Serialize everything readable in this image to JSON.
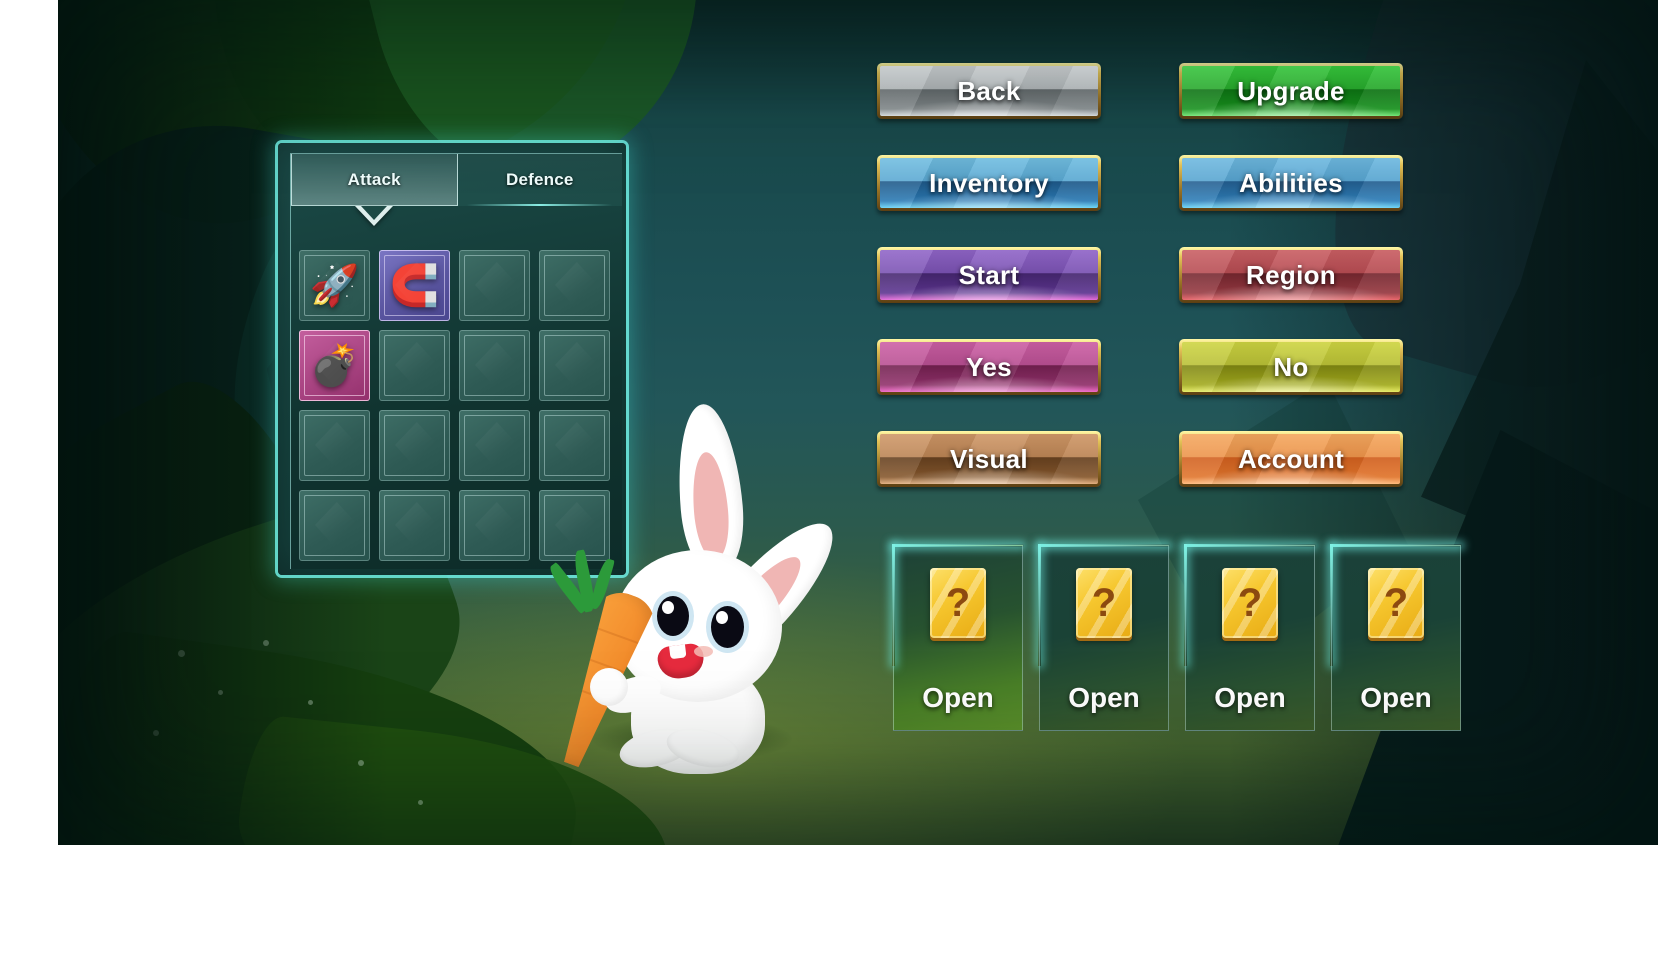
{
  "scene": {
    "theme": "jungle-night",
    "colors": {
      "background_top": "#18484a",
      "background_mid": "#225659",
      "background_ground": "#44632f",
      "panel_glow": "#6eebe1",
      "gold_border": "#e3c258"
    }
  },
  "inventory_panel": {
    "tabs": [
      {
        "label": "Attack",
        "active": true
      },
      {
        "label": "Defence",
        "active": false
      }
    ],
    "slots": [
      {
        "index": 1,
        "icon": "rocket-icon",
        "glyph": "🚀",
        "rarity": "common",
        "filled": true
      },
      {
        "index": 2,
        "icon": "magnet-icon",
        "glyph": "🧲",
        "rarity": "rare",
        "filled": true
      },
      {
        "index": 3,
        "icon": "empty-slot",
        "glyph": "",
        "rarity": "common",
        "filled": false
      },
      {
        "index": 4,
        "icon": "empty-slot",
        "glyph": "",
        "rarity": "common",
        "filled": false
      },
      {
        "index": 5,
        "icon": "bomb-icon",
        "glyph": "💣",
        "rarity": "epic",
        "filled": true
      },
      {
        "index": 6,
        "icon": "empty-slot",
        "glyph": "",
        "rarity": "common",
        "filled": false
      },
      {
        "index": 7,
        "icon": "empty-slot",
        "glyph": "",
        "rarity": "common",
        "filled": false
      },
      {
        "index": 8,
        "icon": "empty-slot",
        "glyph": "",
        "rarity": "common",
        "filled": false
      },
      {
        "index": 9,
        "icon": "empty-slot",
        "glyph": "",
        "rarity": "common",
        "filled": false
      },
      {
        "index": 10,
        "icon": "empty-slot",
        "glyph": "",
        "rarity": "common",
        "filled": false
      },
      {
        "index": 11,
        "icon": "empty-slot",
        "glyph": "",
        "rarity": "common",
        "filled": false
      },
      {
        "index": 12,
        "icon": "empty-slot",
        "glyph": "",
        "rarity": "common",
        "filled": false
      },
      {
        "index": 13,
        "icon": "empty-slot",
        "glyph": "",
        "rarity": "common",
        "filled": false
      },
      {
        "index": 14,
        "icon": "empty-slot",
        "glyph": "",
        "rarity": "common",
        "filled": false
      },
      {
        "index": 15,
        "icon": "empty-slot",
        "glyph": "",
        "rarity": "common",
        "filled": false
      },
      {
        "index": 16,
        "icon": "empty-slot",
        "glyph": "",
        "rarity": "common",
        "filled": false
      }
    ]
  },
  "menu": {
    "rows": [
      {
        "left": {
          "label": "Back",
          "color_top": "#b9bec0",
          "color_bottom": "#6a7173",
          "glow": "#e8edef"
        },
        "right": {
          "label": "Upgrade",
          "color_top": "#2bb431",
          "color_bottom": "#0f7a17",
          "glow": "#8dff8a"
        }
      },
      {
        "left": {
          "label": "Inventory",
          "color_top": "#69b6da",
          "color_bottom": "#1f5c92",
          "glow": "#7fd9ff"
        },
        "right": {
          "label": "Abilities",
          "color_top": "#65b0db",
          "color_bottom": "#2268a4",
          "glow": "#7fd9ff"
        }
      },
      {
        "left": {
          "label": "Start",
          "color_top": "#8b5fc0",
          "color_bottom": "#4a2a7a",
          "glow": "#f26ce0"
        },
        "right": {
          "label": "Region",
          "color_top": "#c3555c",
          "color_bottom": "#7d2a33",
          "glow": "#ff7b7b"
        }
      },
      {
        "left": {
          "label": "Yes",
          "color_top": "#c8569e",
          "color_bottom": "#7a2356",
          "glow": "#ff6fd2"
        },
        "right": {
          "label": "No",
          "color_top": "#c7ce3c",
          "color_bottom": "#8c9314",
          "glow": "#f0ff6a"
        }
      },
      {
        "left": {
          "label": "Visual",
          "color_top": "#cb9262",
          "color_bottom": "#6e4626",
          "glow": "#ffc58e"
        },
        "right": {
          "label": "Account",
          "color_top": "#f2a45c",
          "color_bottom": "#dd6a26",
          "glow": "#ffc07a"
        }
      }
    ]
  },
  "chests": [
    {
      "label": "Open",
      "symbol": "?",
      "highlighted": true
    },
    {
      "label": "Open",
      "symbol": "?",
      "highlighted": false
    },
    {
      "label": "Open",
      "symbol": "?",
      "highlighted": false
    },
    {
      "label": "Open",
      "symbol": "?",
      "highlighted": false
    }
  ],
  "character": {
    "name": "bunny-with-carrot"
  }
}
